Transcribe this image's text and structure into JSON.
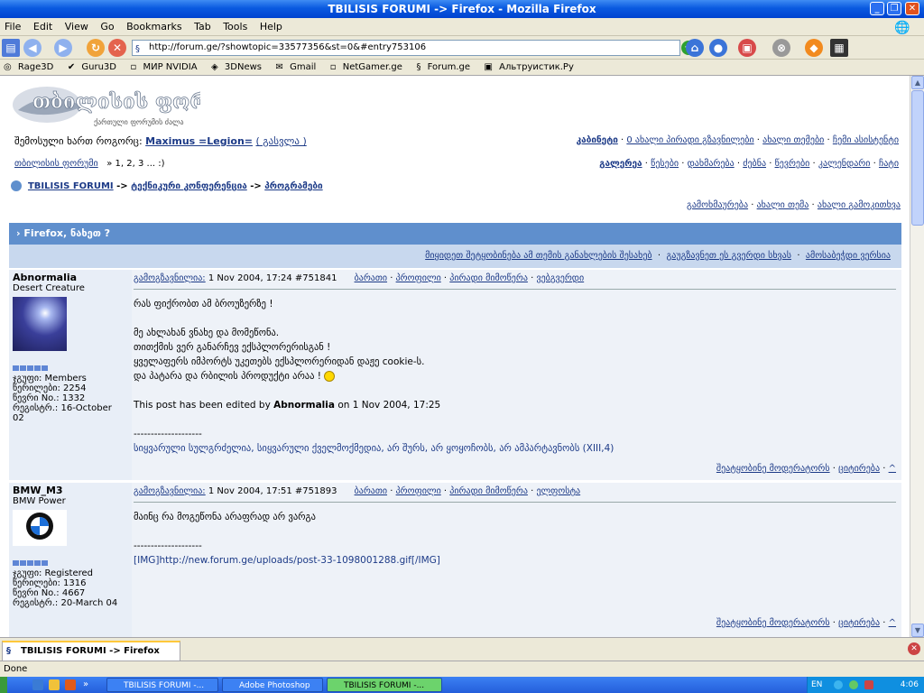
{
  "window": {
    "title": "TBILISIS FORUMI -> Firefox - Mozilla Firefox"
  },
  "menu": [
    "File",
    "Edit",
    "View",
    "Go",
    "Bookmarks",
    "Tab",
    "Tools",
    "Help"
  ],
  "nav": {
    "url": "http://forum.ge/?showtopic=33577356&st=0&#entry753106"
  },
  "bookmarks": [
    "Rage3D",
    "Guru3D",
    "МИР NVIDIA",
    "3DNews",
    "Gmail",
    "NetGamer.ge",
    "Forum.ge",
    "Альтруистик.Ру"
  ],
  "page": {
    "logo_line1": "თბილისის ფორუმი",
    "logo_line2": "ქართული ფორუმის ძალა",
    "logged_in": "შემოსული ხართ როგორც:",
    "username": "Maximus =Legion=",
    "logout": "( გასვლა )",
    "top_links": [
      "კაბინეტი",
      "0 ახალი პირადი გზავნილები",
      "ახალი თემები",
      "ჩემი ასისტენტი"
    ],
    "forum_name": "თბილისის ფორუმი",
    "pages": "» 1, 2, 3 ... :)",
    "sec_links": [
      "გალერეა",
      "წესები",
      "დახმარება",
      "ძებნა",
      "წევრები",
      "კალენდარი",
      "ჩატი"
    ],
    "breadcrumb": [
      "TBILISIS FORUMI",
      "->",
      "ტექნიკური კონფერენცია",
      "->",
      "პროგრამები"
    ],
    "reply_links": [
      "გამოხმაურება",
      "ახალი თემა",
      "ახალი გამოკითხვა"
    ],
    "topic_title": "Firefox, ნახეთ ?",
    "topic_actions": [
      "მიყიდეთ შეტყობინება ამ თემის განახლების შესახებ",
      "გაუგზავნეთ ეს გვერდი სხვას",
      "ამოსაბეჭდი ვერსია"
    ]
  },
  "posts": [
    {
      "username": "Abnormalia",
      "title": "Desert Creature",
      "group": "ჯგუფი: Members",
      "posts": "წერილები: 2254",
      "member_no": "წევრი No.: 1332",
      "registered": "რეგისტრ.: 16-October 02",
      "posted_label": "გამოგზავნილია:",
      "date": "1 Nov 2004, 17:24",
      "entry": "#751841",
      "actions": [
        "ბარათი",
        "პროფილი",
        "პირადი მიმოწერა",
        "ვებგვერდი"
      ],
      "lines": [
        "რას ფიქრობთ ამ ბროუზერზე !",
        "",
        "მე ახლახან ვნახე და მომეწონა.",
        "თითქმის ვერ განარჩევ ექსპლორერისგან !",
        "ყველაფერს იმპორტს უკეთებს ექსპლორერიდან დაჟე cookie-ს.",
        "და პატარა და რბილის პროდუქტი არაა !"
      ],
      "edited_prefix": "This post has been edited by",
      "edited_by": "Abnormalia",
      "edited_suffix": "on 1 Nov 2004, 17:25",
      "signature_rule": "--------------------",
      "signature": "სიყვარული სულგრძელია, სიყვარული ქველმოქმედია, არ შურს, არ ყოყოჩობს, არ ამპარტავნობს (XIII,4)",
      "foot": [
        "შეატყობინე მოდერატორს",
        "ციტირება"
      ]
    },
    {
      "username": "BMW_M3",
      "title": "BMW Power",
      "group": "ჯგუფი: Registered",
      "posts": "წერილები: 1316",
      "member_no": "წევრი No.: 4667",
      "registered": "რეგისტრ.: 20-March 04",
      "posted_label": "გამოგზავნილია:",
      "date": "1 Nov 2004, 17:51",
      "entry": "#751893",
      "actions": [
        "ბარათი",
        "პროფილი",
        "პირადი მიმოწერა",
        "ელფოსტა"
      ],
      "lines": [
        "მაინც რა მოგეწონა არაფრად არ ვარგა"
      ],
      "signature_rule": "--------------------",
      "signature": "[IMG]http://new.forum.ge/uploads/post-33-1098001288.gif[/IMG]",
      "foot": [
        "შეატყობინე მოდერატორს",
        "ციტირება"
      ]
    }
  ],
  "tab": {
    "label": "TBILISIS FORUMI -> Firefox"
  },
  "status": {
    "text": "Done"
  },
  "taskbar": {
    "tasks": [
      "TBILISIS FORUMI -...",
      "Adobe Photoshop",
      "TBILISIS FORUMI -..."
    ],
    "lang": "EN",
    "clock": "4:06"
  }
}
